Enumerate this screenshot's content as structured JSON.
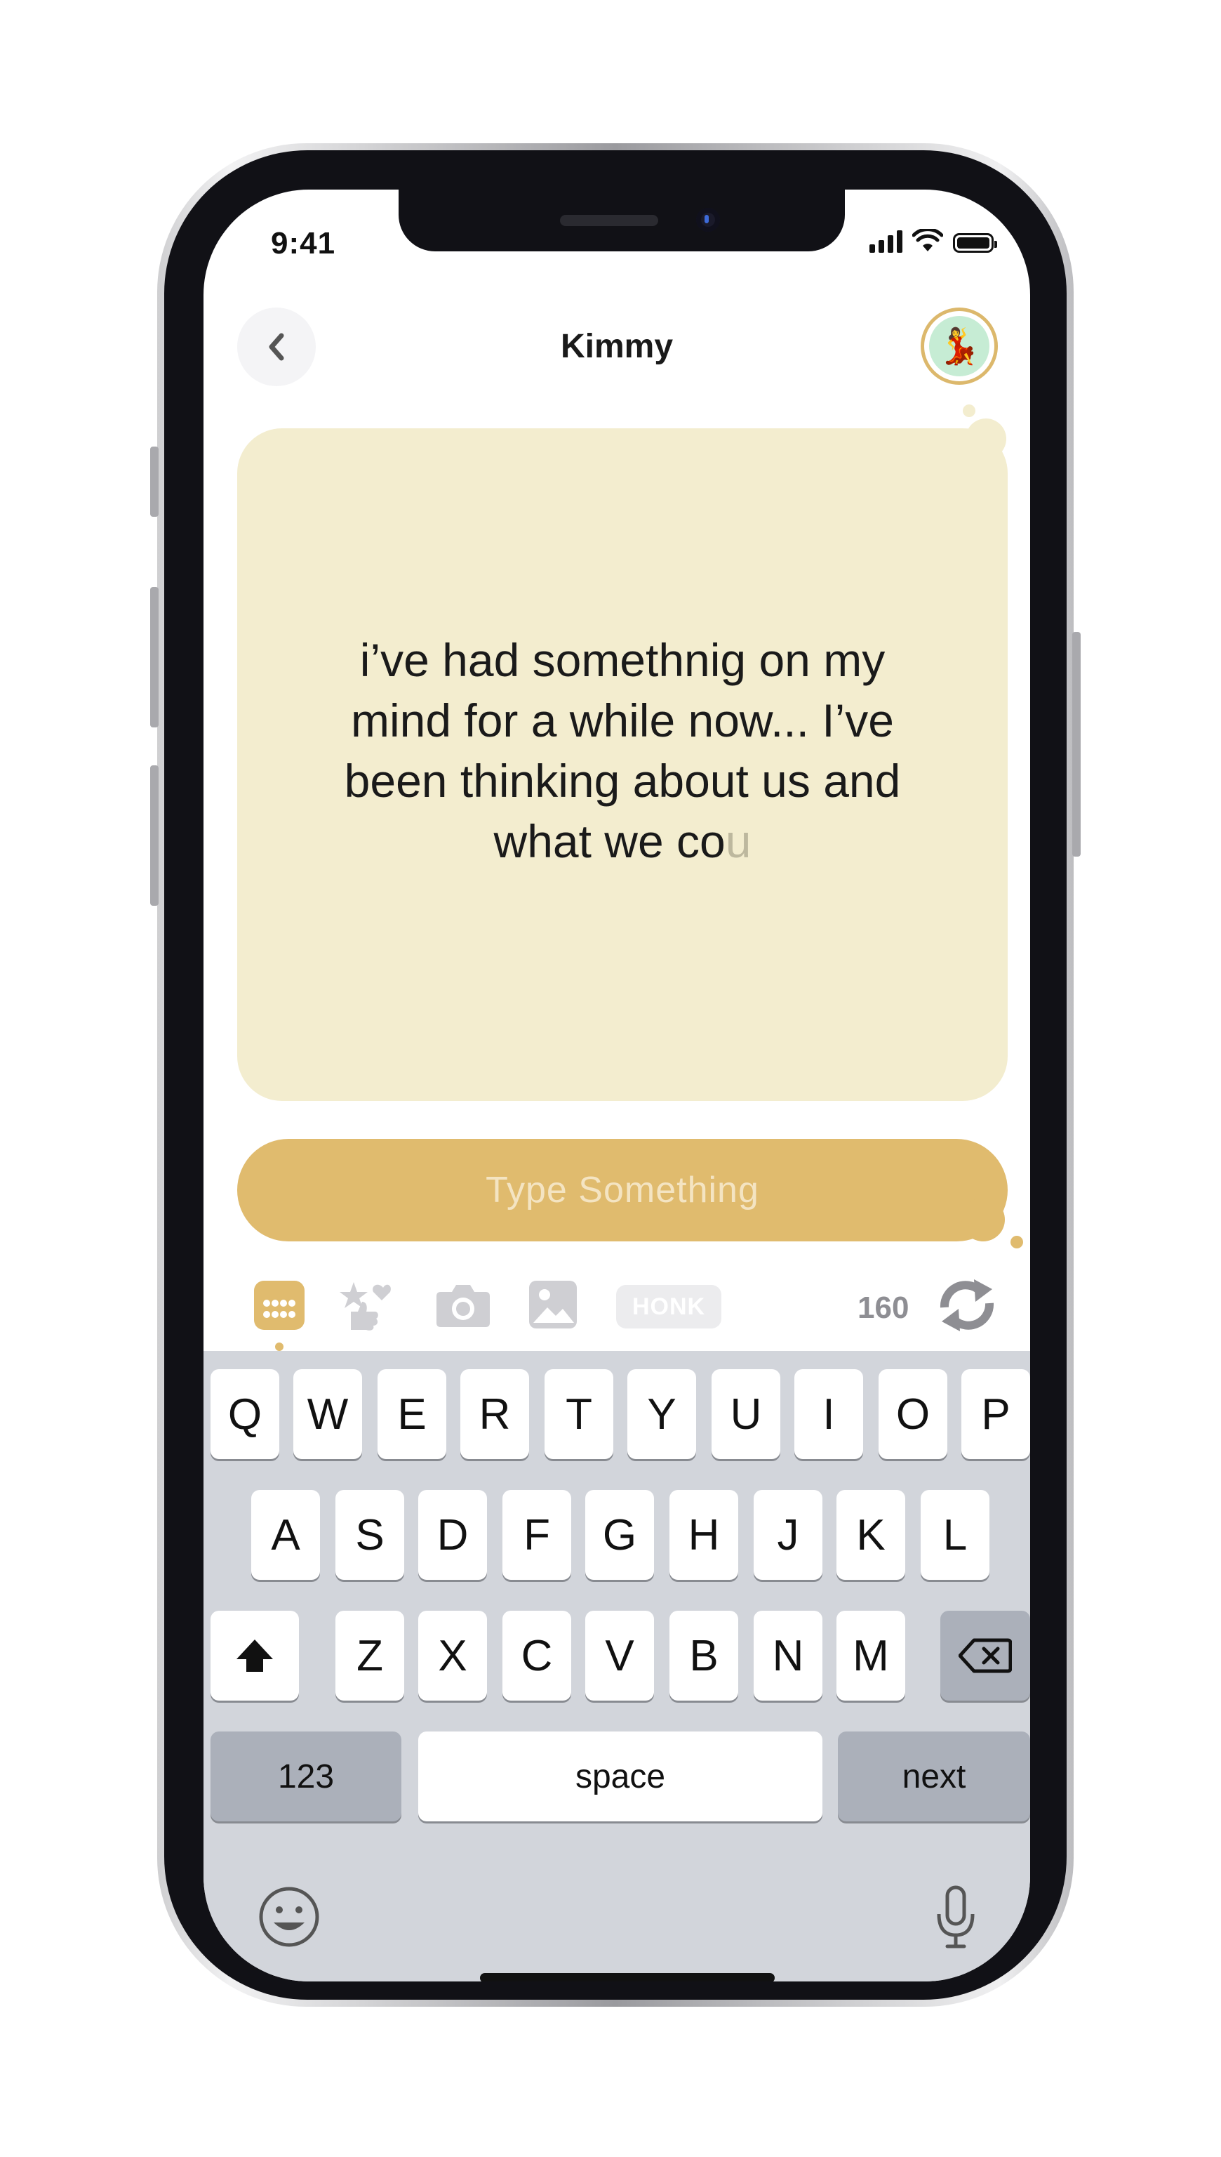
{
  "status_bar": {
    "time": "9:41"
  },
  "header": {
    "title": "Kimmy",
    "back_icon": "chevron-left-icon",
    "avatar_icon": "dancer-avatar"
  },
  "message": {
    "text": "i’ve had somethnig on my mind for a while now... I’ve been thinking about us and what we co",
    "fading_char": "u"
  },
  "input": {
    "placeholder": "Type Something"
  },
  "toolbar": {
    "icons": [
      "keyboard-icon",
      "stickers-icon",
      "camera-icon",
      "image-icon",
      "honk-button",
      "refresh-icon"
    ],
    "honk_label": "HONK",
    "char_count": "160"
  },
  "keyboard": {
    "row1": [
      "Q",
      "W",
      "E",
      "R",
      "T",
      "Y",
      "U",
      "I",
      "O",
      "P"
    ],
    "row2": [
      "A",
      "S",
      "D",
      "F",
      "G",
      "H",
      "J",
      "K",
      "L"
    ],
    "row3": [
      "Z",
      "X",
      "C",
      "V",
      "B",
      "N",
      "M"
    ],
    "numbers_label": "123",
    "space_label": "space",
    "next_label": "next"
  },
  "colors": {
    "accent": "#E0BB6E",
    "card": "#F3EDCF",
    "keyboard_bg": "#D2D5DB"
  }
}
